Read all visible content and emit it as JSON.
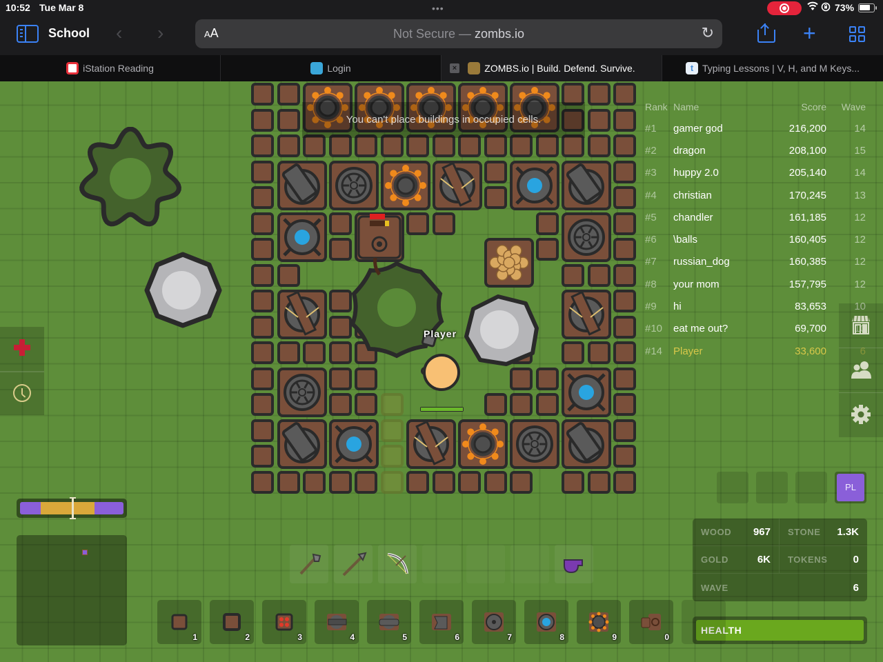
{
  "status_bar": {
    "time": "10:52",
    "date": "Tue Mar 8",
    "battery_percent": "73%",
    "screen_recording": true
  },
  "browser": {
    "tab_group": "School",
    "reader_label_small": "A",
    "reader_label_big": "A",
    "url_prefix": "Not Secure —",
    "url_host": "zombs.io",
    "icons": {
      "sidebar": "sidebar-icon",
      "back": "chevron-left-icon",
      "forward": "chevron-right-icon",
      "reload": "reload-icon",
      "share": "share-icon",
      "new_tab": "plus-icon",
      "tabs_overview": "grid-icon"
    },
    "tabs": [
      {
        "title": "iStation Reading",
        "favicon_color": "#e8303a",
        "active": false
      },
      {
        "title": "Login",
        "favicon_color": "#3aa6d8",
        "active": false
      },
      {
        "title": "ZOMBS.io | Build. Defend. Survive.",
        "favicon_color": "#9a7a3a",
        "active": true,
        "close_label": "×"
      },
      {
        "title": "Typing Lessons | V, H, and M Keys...",
        "favicon_color": "#4a90d9",
        "active": false,
        "favicon_letter": "t"
      }
    ]
  },
  "game": {
    "message": "You can't place buildings in occupied cells.",
    "player_name": "Player",
    "player_health_fraction": 1.0,
    "leaderboard": {
      "headers": {
        "rank": "Rank",
        "name": "Name",
        "score": "Score",
        "wave": "Wave"
      },
      "rows": [
        {
          "rank": "#1",
          "name": "gamer god",
          "score": "216,200",
          "wave": "14"
        },
        {
          "rank": "#2",
          "name": "dragon",
          "score": "208,100",
          "wave": "15"
        },
        {
          "rank": "#3",
          "name": "huppy 2.0",
          "score": "205,140",
          "wave": "14"
        },
        {
          "rank": "#4",
          "name": "christian",
          "score": "170,245",
          "wave": "13"
        },
        {
          "rank": "#5",
          "name": "chandler",
          "score": "161,185",
          "wave": "12"
        },
        {
          "rank": "#6",
          "name": "\\balls",
          "score": "160,405",
          "wave": "12"
        },
        {
          "rank": "#7",
          "name": "russian_dog",
          "score": "160,385",
          "wave": "12"
        },
        {
          "rank": "#8",
          "name": "your mom",
          "score": "157,795",
          "wave": "12"
        },
        {
          "rank": "#9",
          "name": "hi",
          "score": "83,653",
          "wave": "10"
        },
        {
          "rank": "#10",
          "name": "eat me out?",
          "score": "69,700",
          "wave": "10"
        },
        {
          "rank": "#14",
          "name": "Player",
          "score": "33,600",
          "wave": "6",
          "is_self": true
        }
      ]
    },
    "left_panel": {
      "heal_icon": "red-cross-icon",
      "timer_icon": "clock-icon"
    },
    "day_night": {
      "day_start_fraction": 0.2,
      "day_end_fraction": 0.72,
      "current_fraction": 0.5
    },
    "right_menu": {
      "items": [
        "shop-icon",
        "party-icon",
        "settings-icon"
      ]
    },
    "party": {
      "slots": [
        "",
        "",
        ""
      ],
      "self_label": "PL",
      "self_color": "#8a5fd9"
    },
    "resources": {
      "wood": {
        "label": "WOOD",
        "value": "967"
      },
      "stone": {
        "label": "STONE",
        "value": "1.3K"
      },
      "gold": {
        "label": "GOLD",
        "value": "6K"
      },
      "tokens": {
        "label": "TOKENS",
        "value": "0"
      },
      "wave": {
        "label": "WAVE",
        "value": "6"
      }
    },
    "health": {
      "label": "HEALTH",
      "fraction": 1.0,
      "color": "#6aa81e"
    },
    "weapons": [
      {
        "name": "pickaxe",
        "icon": "pickaxe-icon"
      },
      {
        "name": "spear",
        "icon": "spear-icon"
      },
      {
        "name": "bow",
        "icon": "bow-icon"
      },
      {
        "name": "empty",
        "icon": ""
      },
      {
        "name": "empty",
        "icon": ""
      },
      {
        "name": "empty",
        "icon": ""
      },
      {
        "name": "health-potion",
        "icon": "whistle-icon"
      }
    ],
    "buildings": [
      {
        "key": "1",
        "name": "wall",
        "icon": "wall-icon"
      },
      {
        "key": "2",
        "name": "door",
        "icon": "door-icon"
      },
      {
        "key": "3",
        "name": "slow-trap",
        "icon": "slow-trap-icon"
      },
      {
        "key": "4",
        "name": "arrow-tower",
        "icon": "arrow-tower-icon"
      },
      {
        "key": "5",
        "name": "cannon-tower",
        "icon": "cannon-tower-icon"
      },
      {
        "key": "6",
        "name": "melee-tower",
        "icon": "melee-tower-icon"
      },
      {
        "key": "7",
        "name": "bomb-tower",
        "icon": "bomb-tower-icon"
      },
      {
        "key": "8",
        "name": "mage-tower",
        "icon": "mage-tower-icon"
      },
      {
        "key": "9",
        "name": "gold-mine",
        "icon": "gold-mine-icon"
      },
      {
        "key": "0",
        "name": "harvester",
        "icon": "harvester-icon"
      }
    ]
  }
}
